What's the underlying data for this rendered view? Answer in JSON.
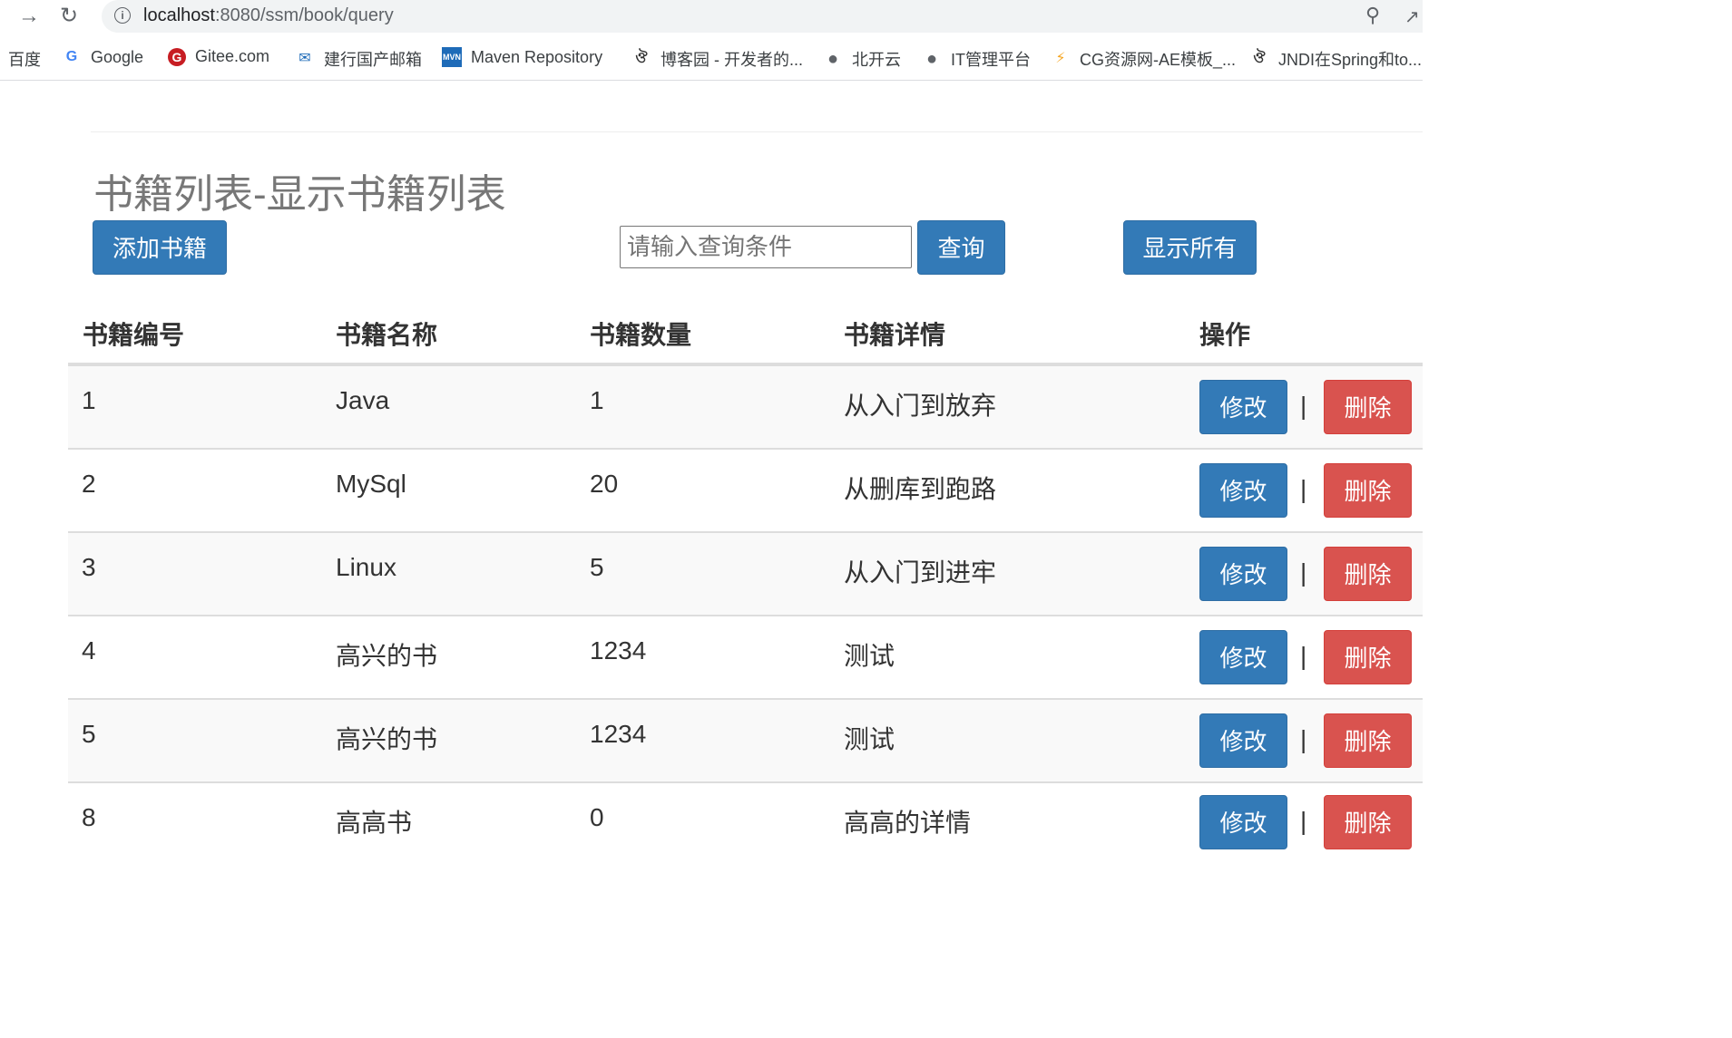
{
  "browser": {
    "url_host": "localhost",
    "url_path": ":8080/ssm/book/query",
    "icons": [
      "back-arrow-icon",
      "reload-icon",
      "info-icon",
      "zoom-icon",
      "share-icon"
    ]
  },
  "bookmarks": [
    {
      "label": "百度",
      "icon": ""
    },
    {
      "label": "Google",
      "icon": "G"
    },
    {
      "label": "Gitee.com",
      "icon": "G"
    },
    {
      "label": "建行国产邮箱",
      "icon": "✉"
    },
    {
      "label": "Maven Repository",
      "icon": "MVN"
    },
    {
      "label": "博客园 - 开发者的...",
      "icon": "ঔ"
    },
    {
      "label": "北开云",
      "icon": "●"
    },
    {
      "label": "IT管理平台",
      "icon": "●"
    },
    {
      "label": "CG资源网-AE模板_...",
      "icon": "⚡"
    },
    {
      "label": "JNDI在Spring和to...",
      "icon": "ঔ"
    }
  ],
  "page": {
    "title": "书籍列表-显示书籍列表",
    "add_button": "添加书籍",
    "search_placeholder": "请输入查询条件",
    "search_button": "查询",
    "show_all_button": "显示所有"
  },
  "table": {
    "headers": [
      "书籍编号",
      "书籍名称",
      "书籍数量",
      "书籍详情",
      "操作"
    ],
    "edit_label": "修改",
    "delete_label": "删除",
    "separator": "|",
    "rows": [
      {
        "id": "1",
        "name": "Java",
        "count": "1",
        "detail": "从入门到放弃"
      },
      {
        "id": "2",
        "name": "MySql",
        "count": "20",
        "detail": "从删库到跑路"
      },
      {
        "id": "3",
        "name": "Linux",
        "count": "5",
        "detail": "从入门到进牢"
      },
      {
        "id": "4",
        "name": "高兴的书",
        "count": "1234",
        "detail": "测试"
      },
      {
        "id": "5",
        "name": "高兴的书",
        "count": "1234",
        "detail": "测试"
      },
      {
        "id": "8",
        "name": "高高书",
        "count": "0",
        "detail": "高高的详情"
      }
    ]
  },
  "colors": {
    "primary": "#337ab7",
    "danger": "#d9534f",
    "stripe": "#f9f9f9"
  }
}
